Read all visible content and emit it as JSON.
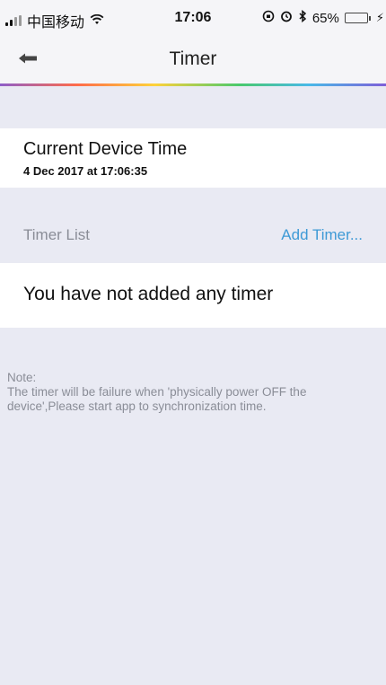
{
  "status_bar": {
    "carrier": "中国移动",
    "time": "17:06",
    "battery_percent": "65%",
    "battery_level": 0.65,
    "icons": [
      "signal-icon",
      "wifi-icon",
      "orientation-lock-icon",
      "alarm-icon",
      "bluetooth-icon",
      "battery-icon",
      "charging-icon"
    ]
  },
  "nav": {
    "title": "Timer",
    "back_icon": "back-arrow-icon"
  },
  "device_time": {
    "title": "Current Device Time",
    "value": "4 Dec 2017 at 17:06:35"
  },
  "timer_list": {
    "label": "Timer List",
    "add_label": "Add Timer...",
    "empty_message": "You have not added any timer"
  },
  "note": {
    "title": "Note:",
    "body": "The timer will be failure when 'physically power OFF the device',Please start app to synchronization time."
  },
  "colors": {
    "accent": "#3e9ad6",
    "background": "#e9eaf3",
    "battery": "#4cd964"
  }
}
